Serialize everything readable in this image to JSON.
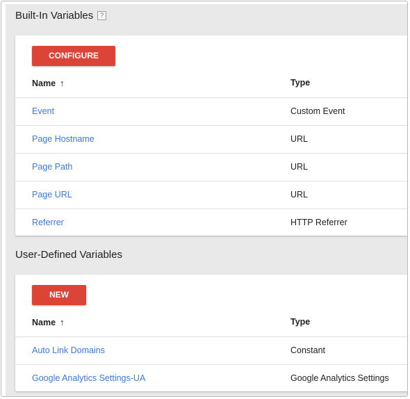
{
  "builtin": {
    "title": "Built-In Variables",
    "help": "?",
    "button": "CONFIGURE",
    "columns": {
      "name": "Name",
      "sort": "↑",
      "type": "Type"
    },
    "rows": [
      {
        "name": "Event",
        "type": "Custom Event"
      },
      {
        "name": "Page Hostname",
        "type": "URL"
      },
      {
        "name": "Page Path",
        "type": "URL"
      },
      {
        "name": "Page URL",
        "type": "URL"
      },
      {
        "name": "Referrer",
        "type": "HTTP Referrer"
      }
    ]
  },
  "userdefined": {
    "title": "User-Defined Variables",
    "button": "NEW",
    "columns": {
      "name": "Name",
      "sort": "↑",
      "type": "Type"
    },
    "rows": [
      {
        "name": "Auto Link Domains",
        "type": "Constant"
      },
      {
        "name": "Google Analytics Settings-UA",
        "type": "Google Analytics Settings"
      }
    ]
  },
  "colors": {
    "accent_button": "#db4437",
    "link": "#3b78e7",
    "panel_background": "#e9e9e9"
  },
  "icons": {
    "sort": "arrow-up-icon",
    "help": "help-icon"
  }
}
